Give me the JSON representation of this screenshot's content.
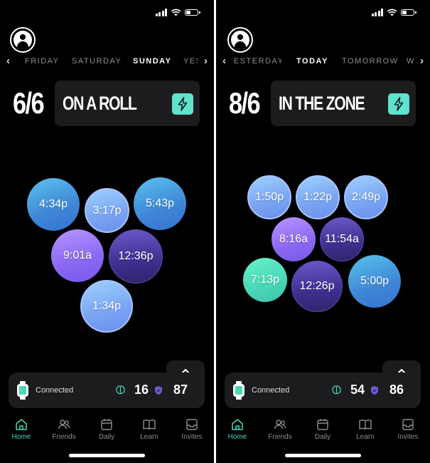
{
  "colors": {
    "accent": "#49d7b8",
    "background": "#000000",
    "panel": "#1c1c1e",
    "muted": "#8e8e93"
  },
  "icons": [
    "avatar-icon",
    "chevron-left-icon",
    "chevron-right-icon",
    "lightning-bolt-icon",
    "chevron-up-icon",
    "watch-icon",
    "brain-icon",
    "shield-icon",
    "home-icon",
    "friends-icon",
    "daily-icon",
    "learn-icon",
    "invites-icon",
    "signal-icon",
    "wifi-icon",
    "battery-icon"
  ],
  "screens": [
    {
      "days": {
        "prev_partial": "FRIDAY",
        "left": "SATURDAY",
        "center": "SUNDAY",
        "next_partial": "YES"
      },
      "score": "6/6",
      "status_label": "ON A ROLL",
      "bubbles": [
        "4:34p",
        "3:17p",
        "5:43p",
        "9:01a",
        "12:36p",
        "1:34p"
      ],
      "connected_label": "Connected",
      "brain_value": "16",
      "shield_value": "87"
    },
    {
      "days": {
        "prev_partial": "YESTERDAY",
        "left": "TODAY",
        "center": "TOMORROW",
        "next_partial": "W"
      },
      "score": "8/6",
      "status_label": "IN THE ZONE",
      "bubbles": [
        "1:50p",
        "1:22p",
        "2:49p",
        "8:16a",
        "11:54a",
        "7:13p",
        "12:26p",
        "5:00p"
      ],
      "connected_label": "Connected",
      "brain_value": "54",
      "shield_value": "86"
    }
  ],
  "tabs": [
    {
      "label": "Home",
      "active": true
    },
    {
      "label": "Friends",
      "active": false
    },
    {
      "label": "Daily",
      "active": false
    },
    {
      "label": "Learn",
      "active": false
    },
    {
      "label": "Invites",
      "active": false
    }
  ]
}
